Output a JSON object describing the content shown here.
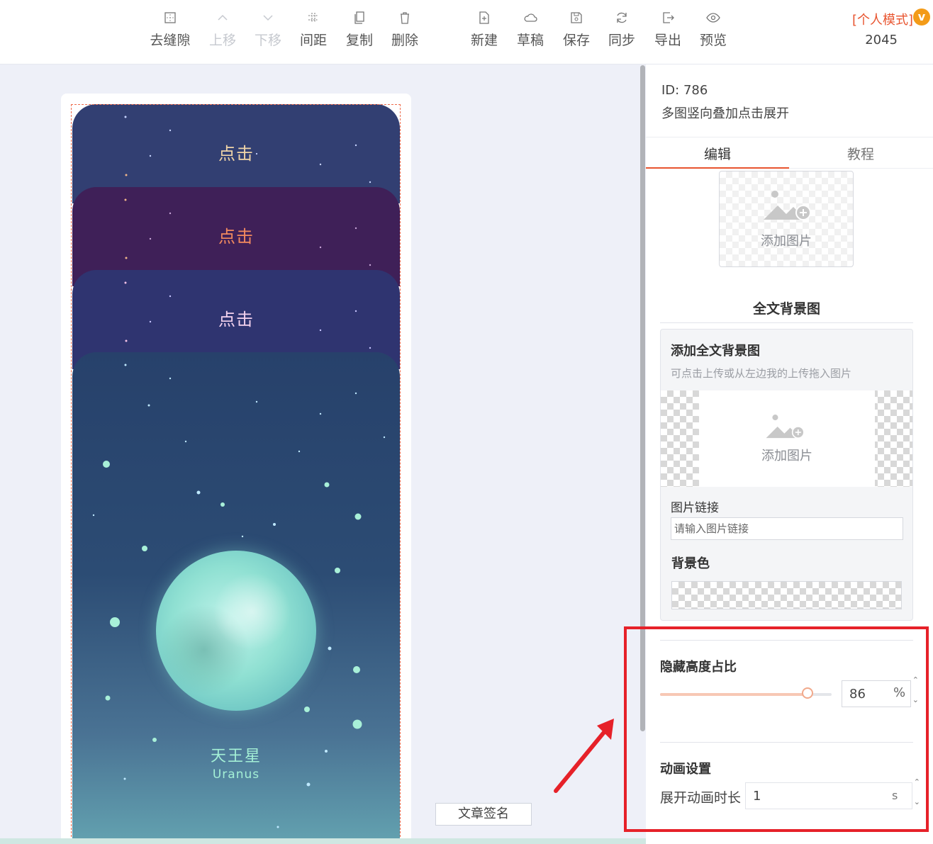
{
  "toolbar": {
    "left_group": [
      {
        "label": "去缝隙",
        "icon": "grid-icon",
        "enabled": true
      },
      {
        "label": "上移",
        "icon": "chevron-up-icon",
        "enabled": false
      },
      {
        "label": "下移",
        "icon": "chevron-down-icon",
        "enabled": false
      },
      {
        "label": "间距",
        "icon": "spacing-icon",
        "enabled": true
      },
      {
        "label": "复制",
        "icon": "copy-icon",
        "enabled": true
      },
      {
        "label": "删除",
        "icon": "trash-icon",
        "enabled": true
      }
    ],
    "right_group": [
      {
        "label": "新建",
        "icon": "new-file-icon"
      },
      {
        "label": "草稿",
        "icon": "cloud-icon"
      },
      {
        "label": "保存",
        "icon": "save-icon"
      },
      {
        "label": "同步",
        "icon": "sync-icon"
      },
      {
        "label": "导出",
        "icon": "export-icon"
      },
      {
        "label": "预览",
        "icon": "eye-icon"
      }
    ],
    "mode_label": "[个人模式]",
    "vip_badge": "v",
    "user_number": "2045"
  },
  "canvas": {
    "cards": [
      {
        "label": "点击",
        "color": "#323f72"
      },
      {
        "label": "点击",
        "color": "#3f2058"
      },
      {
        "label": "点击",
        "color": "#2f3470"
      }
    ],
    "planet_name_cn": "天王星",
    "planet_name_en": "Uranus",
    "signature_button": "文章签名"
  },
  "panel": {
    "id_text": "ID: 786",
    "component_name": "多图竖向叠加点击展开",
    "tabs": [
      {
        "label": "编辑",
        "active": true
      },
      {
        "label": "教程",
        "active": false
      }
    ],
    "upload_label": "添加图片",
    "full_bg_section_title": "全文背景图",
    "full_bg": {
      "title": "添加全文背景图",
      "hint": "可点击上传或从左边我的上传拖入图片",
      "upload_label": "添加图片",
      "link_label": "图片链接",
      "link_placeholder": "请输入图片链接",
      "color_label": "背景色"
    },
    "hide_height": {
      "title": "隐藏高度占比",
      "value": "86",
      "unit": "%",
      "fraction": 0.86
    },
    "animation": {
      "title": "动画设置",
      "duration_label": "展开动画时长",
      "duration_value": "1",
      "duration_unit": "s"
    }
  },
  "colors": {
    "accent": "#e8542f",
    "annotation_red": "#e62129"
  }
}
